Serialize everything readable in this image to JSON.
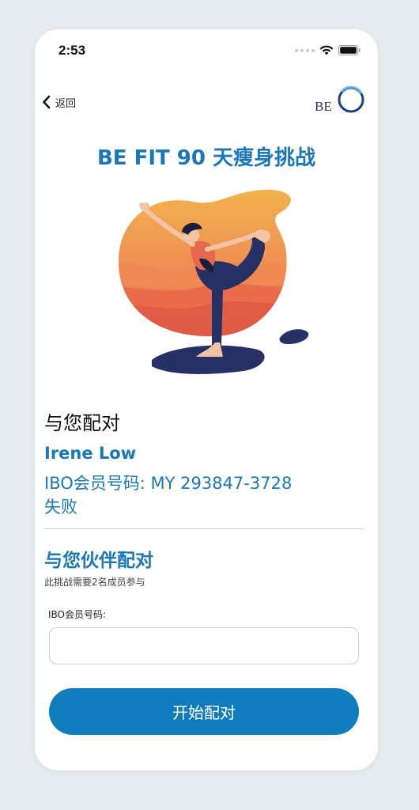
{
  "status_bar": {
    "time": "2:53"
  },
  "nav": {
    "back_label": "返回",
    "logo_text": "BE"
  },
  "challenge": {
    "title": "BE FIT 90 天瘦身挑战"
  },
  "paired": {
    "heading": "与您配对",
    "name": "Irene Low",
    "ibo_line": "IBO会员号码: MY 293847-3728",
    "status": "失败"
  },
  "partner": {
    "heading": "与您伙伴配对",
    "note": "此挑战需要2名成员参与",
    "field_label": "IBO会员号码:",
    "input_value": "",
    "input_placeholder": ""
  },
  "action": {
    "start_label": "开始配对"
  },
  "colors": {
    "accent": "#1a78b8",
    "button": "#0f7cbd",
    "navy": "#283165",
    "orange": "#e8904a"
  },
  "icons": [
    "back-chevron-icon",
    "signal-icon",
    "wifi-icon",
    "battery-icon",
    "logo-ring-icon"
  ]
}
